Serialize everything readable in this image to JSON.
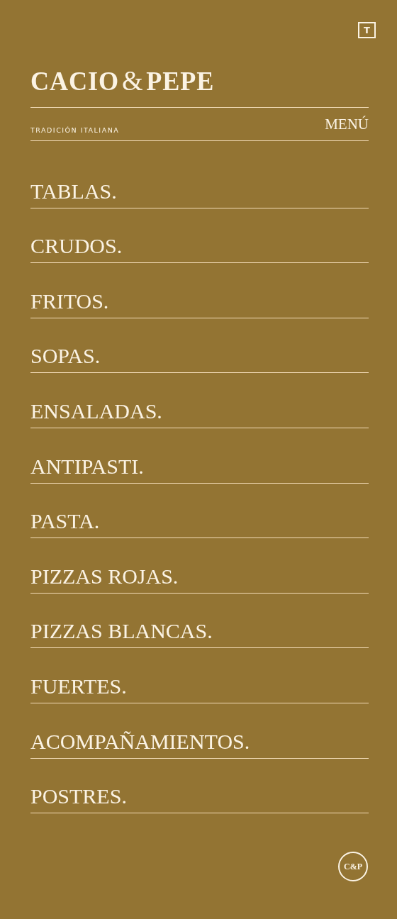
{
  "top_button": {
    "label": "T"
  },
  "logo": {
    "left": "CACIO",
    "amp": "&",
    "right": "PEPE"
  },
  "tagline": "TRADICIÓN ITALIANA",
  "menu_link": "MENÚ",
  "categories": [
    {
      "label": "TABLAS."
    },
    {
      "label": "CRUDOS."
    },
    {
      "label": "FRITOS."
    },
    {
      "label": "SOPAS."
    },
    {
      "label": "ENSALADAS."
    },
    {
      "label": "ANTIPASTI."
    },
    {
      "label": "PASTA."
    },
    {
      "label": "PIZZAS ROJAS."
    },
    {
      "label": "PIZZAS BLANCAS."
    },
    {
      "label": "FUERTES."
    },
    {
      "label": "ACOMPAÑAMIENTOS."
    },
    {
      "label": "POSTRES."
    }
  ],
  "footer_badge": "C&P"
}
